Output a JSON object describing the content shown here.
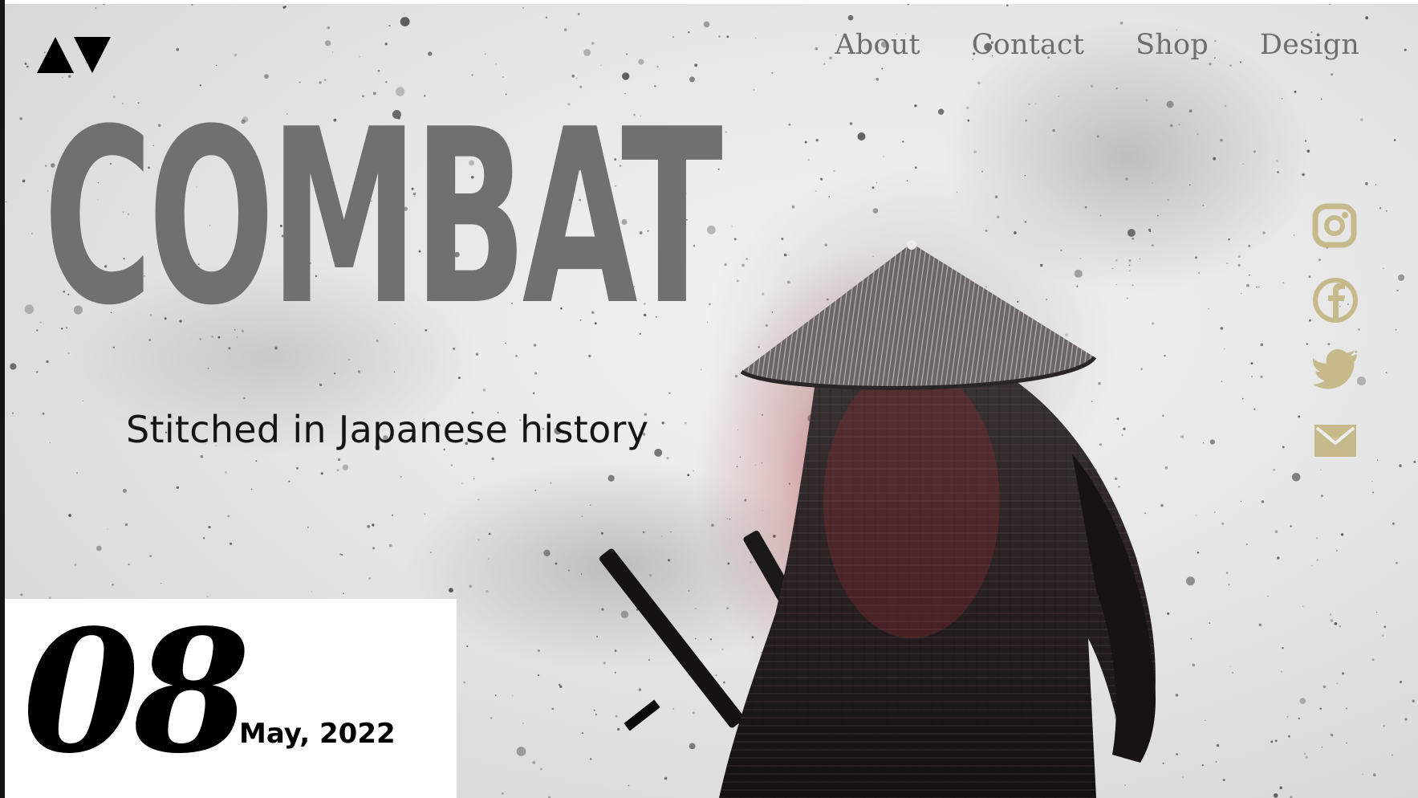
{
  "brand": {
    "logo_icon": "av-triangles-logo"
  },
  "nav": {
    "items": [
      {
        "label": "About"
      },
      {
        "label": "Contact"
      },
      {
        "label": "Shop"
      },
      {
        "label": "Design"
      }
    ]
  },
  "hero": {
    "headline": "COMBAT",
    "tagline": "Stitched in Japanese history",
    "image": "samurai-illustration"
  },
  "social": {
    "color": "#c6ba8c",
    "items": [
      {
        "icon": "instagram-icon"
      },
      {
        "icon": "facebook-icon"
      },
      {
        "icon": "twitter-icon"
      },
      {
        "icon": "mail-icon"
      }
    ]
  },
  "date": {
    "day": "08",
    "month_year": "May, 2022"
  },
  "colors": {
    "headline": "#707070",
    "text": "#151515",
    "nav": "#6e6e6e",
    "accent_red": "#a8383c"
  }
}
